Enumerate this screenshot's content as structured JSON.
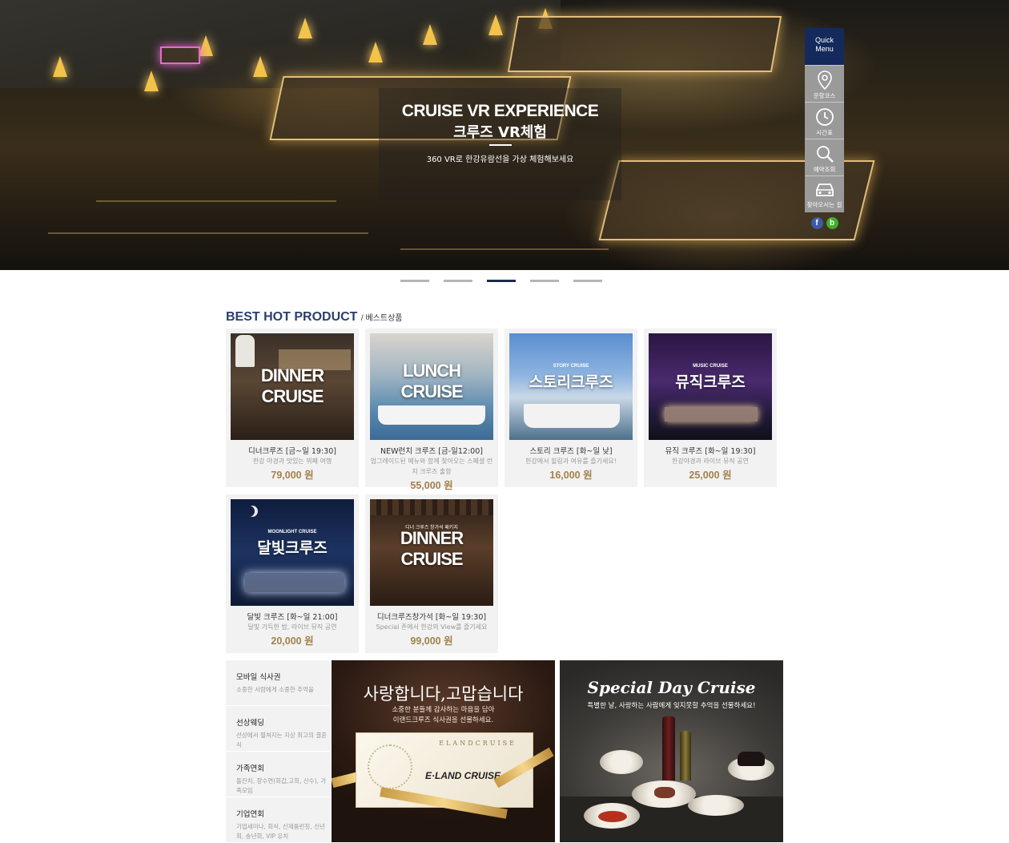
{
  "hero": {
    "title_en": "CRUISE VR EXPERIENCE",
    "title_ko": "크루즈 VR체험",
    "subtitle": "360 VR로 한강유람선을 가상 체험해보세요"
  },
  "quick_menu": {
    "title_line1": "Quick",
    "title_line2": "Menu",
    "items": [
      {
        "label": "운항코스",
        "icon": "location-pin-icon"
      },
      {
        "label": "시간표",
        "icon": "clock-icon"
      },
      {
        "label": "예약조회",
        "icon": "search-icon"
      },
      {
        "label": "찾아오시는 길",
        "icon": "car-icon"
      }
    ],
    "social": {
      "facebook": "f",
      "blog": "b"
    }
  },
  "pager": {
    "count": 5,
    "active_index": 2
  },
  "best": {
    "title": "BEST HOT PRODUCT",
    "subtitle": "/ 베스트상품",
    "products": [
      {
        "thumb_line1": "DINNER",
        "thumb_line2": "CRUISE",
        "title": "디너크루즈 [금~일 19:30]",
        "desc": "한강 야경과 맛있는 뷔페 여행",
        "price": "79,000 원"
      },
      {
        "thumb_line1": "LUNCH",
        "thumb_line2": "CRUISE",
        "title": "NEW런치 크루즈 [금-일12:00]",
        "desc": "업그레이드된 메뉴와 함께 찾아오는 스페셜 런치 크루즈 출항",
        "price": "55,000 원"
      },
      {
        "thumb_small": "STORY CRUISE",
        "thumb_line1": "스토리크루즈",
        "title": "스토리 크루즈 [화~일 낮]",
        "desc": "한강에서 힐링과 여유를 즐기세요!",
        "price": "16,000 원"
      },
      {
        "thumb_small": "MUSIC CRUISE",
        "thumb_line1": "뮤직크루즈",
        "title": "뮤직 크루즈 [화~일 19:30]",
        "desc": "한강야경과 라이브 뮤직 공연",
        "price": "25,000 원"
      },
      {
        "thumb_small": "MOONLIGHT CRUISE",
        "thumb_line1": "달빛크루즈",
        "title": "달빛 크루즈 [화~일 21:00]",
        "desc": "달빛 가득한 밤, 라이브 뮤직 공연",
        "price": "20,000 원"
      },
      {
        "thumb_small": "디너 크루즈 창가석 패키지",
        "thumb_line1": "DINNER",
        "thumb_line2": "CRUISE",
        "title": "디너크루즈창가석 [화~일 19:30]",
        "desc": "Special 존에서 한강의 View를 즐기세요",
        "price": "99,000 원"
      }
    ]
  },
  "side_menu": [
    {
      "title": "모바일 식사권",
      "desc": "소중한 사람에게 소중한 추억을"
    },
    {
      "title": "선상웨딩",
      "desc": "선상에서 펼쳐지는 지상 최고의 결혼식"
    },
    {
      "title": "가족연회",
      "desc": "돌잔치, 장수연(회갑,고희, 산수), 가족모임"
    },
    {
      "title": "기업연회",
      "desc": "기업세미나, 회식, 신제품런칭, 신년회, 송년회, VIP 유치"
    }
  ],
  "banner_gift": {
    "title": "사랑합니다,고맙습니다",
    "sub1": "소중한 분들께 감사하는 마음을 담아",
    "sub2": "이랜드크루즈 식사권을 선물하세요.",
    "ticket_brand": "ELANDCRUISE",
    "ticket_name": "E·LAND CRUISE"
  },
  "banner_special": {
    "title": "Special Day Cruise",
    "sub": "특별한 날, 사랑하는 사람에게 잊지못할 추억을 선물하세요!"
  },
  "colors": {
    "navy": "#142a5c",
    "title_blue": "#2b3f6b",
    "price_gold": "#a2814b",
    "card_bg": "#f2f2f2"
  }
}
